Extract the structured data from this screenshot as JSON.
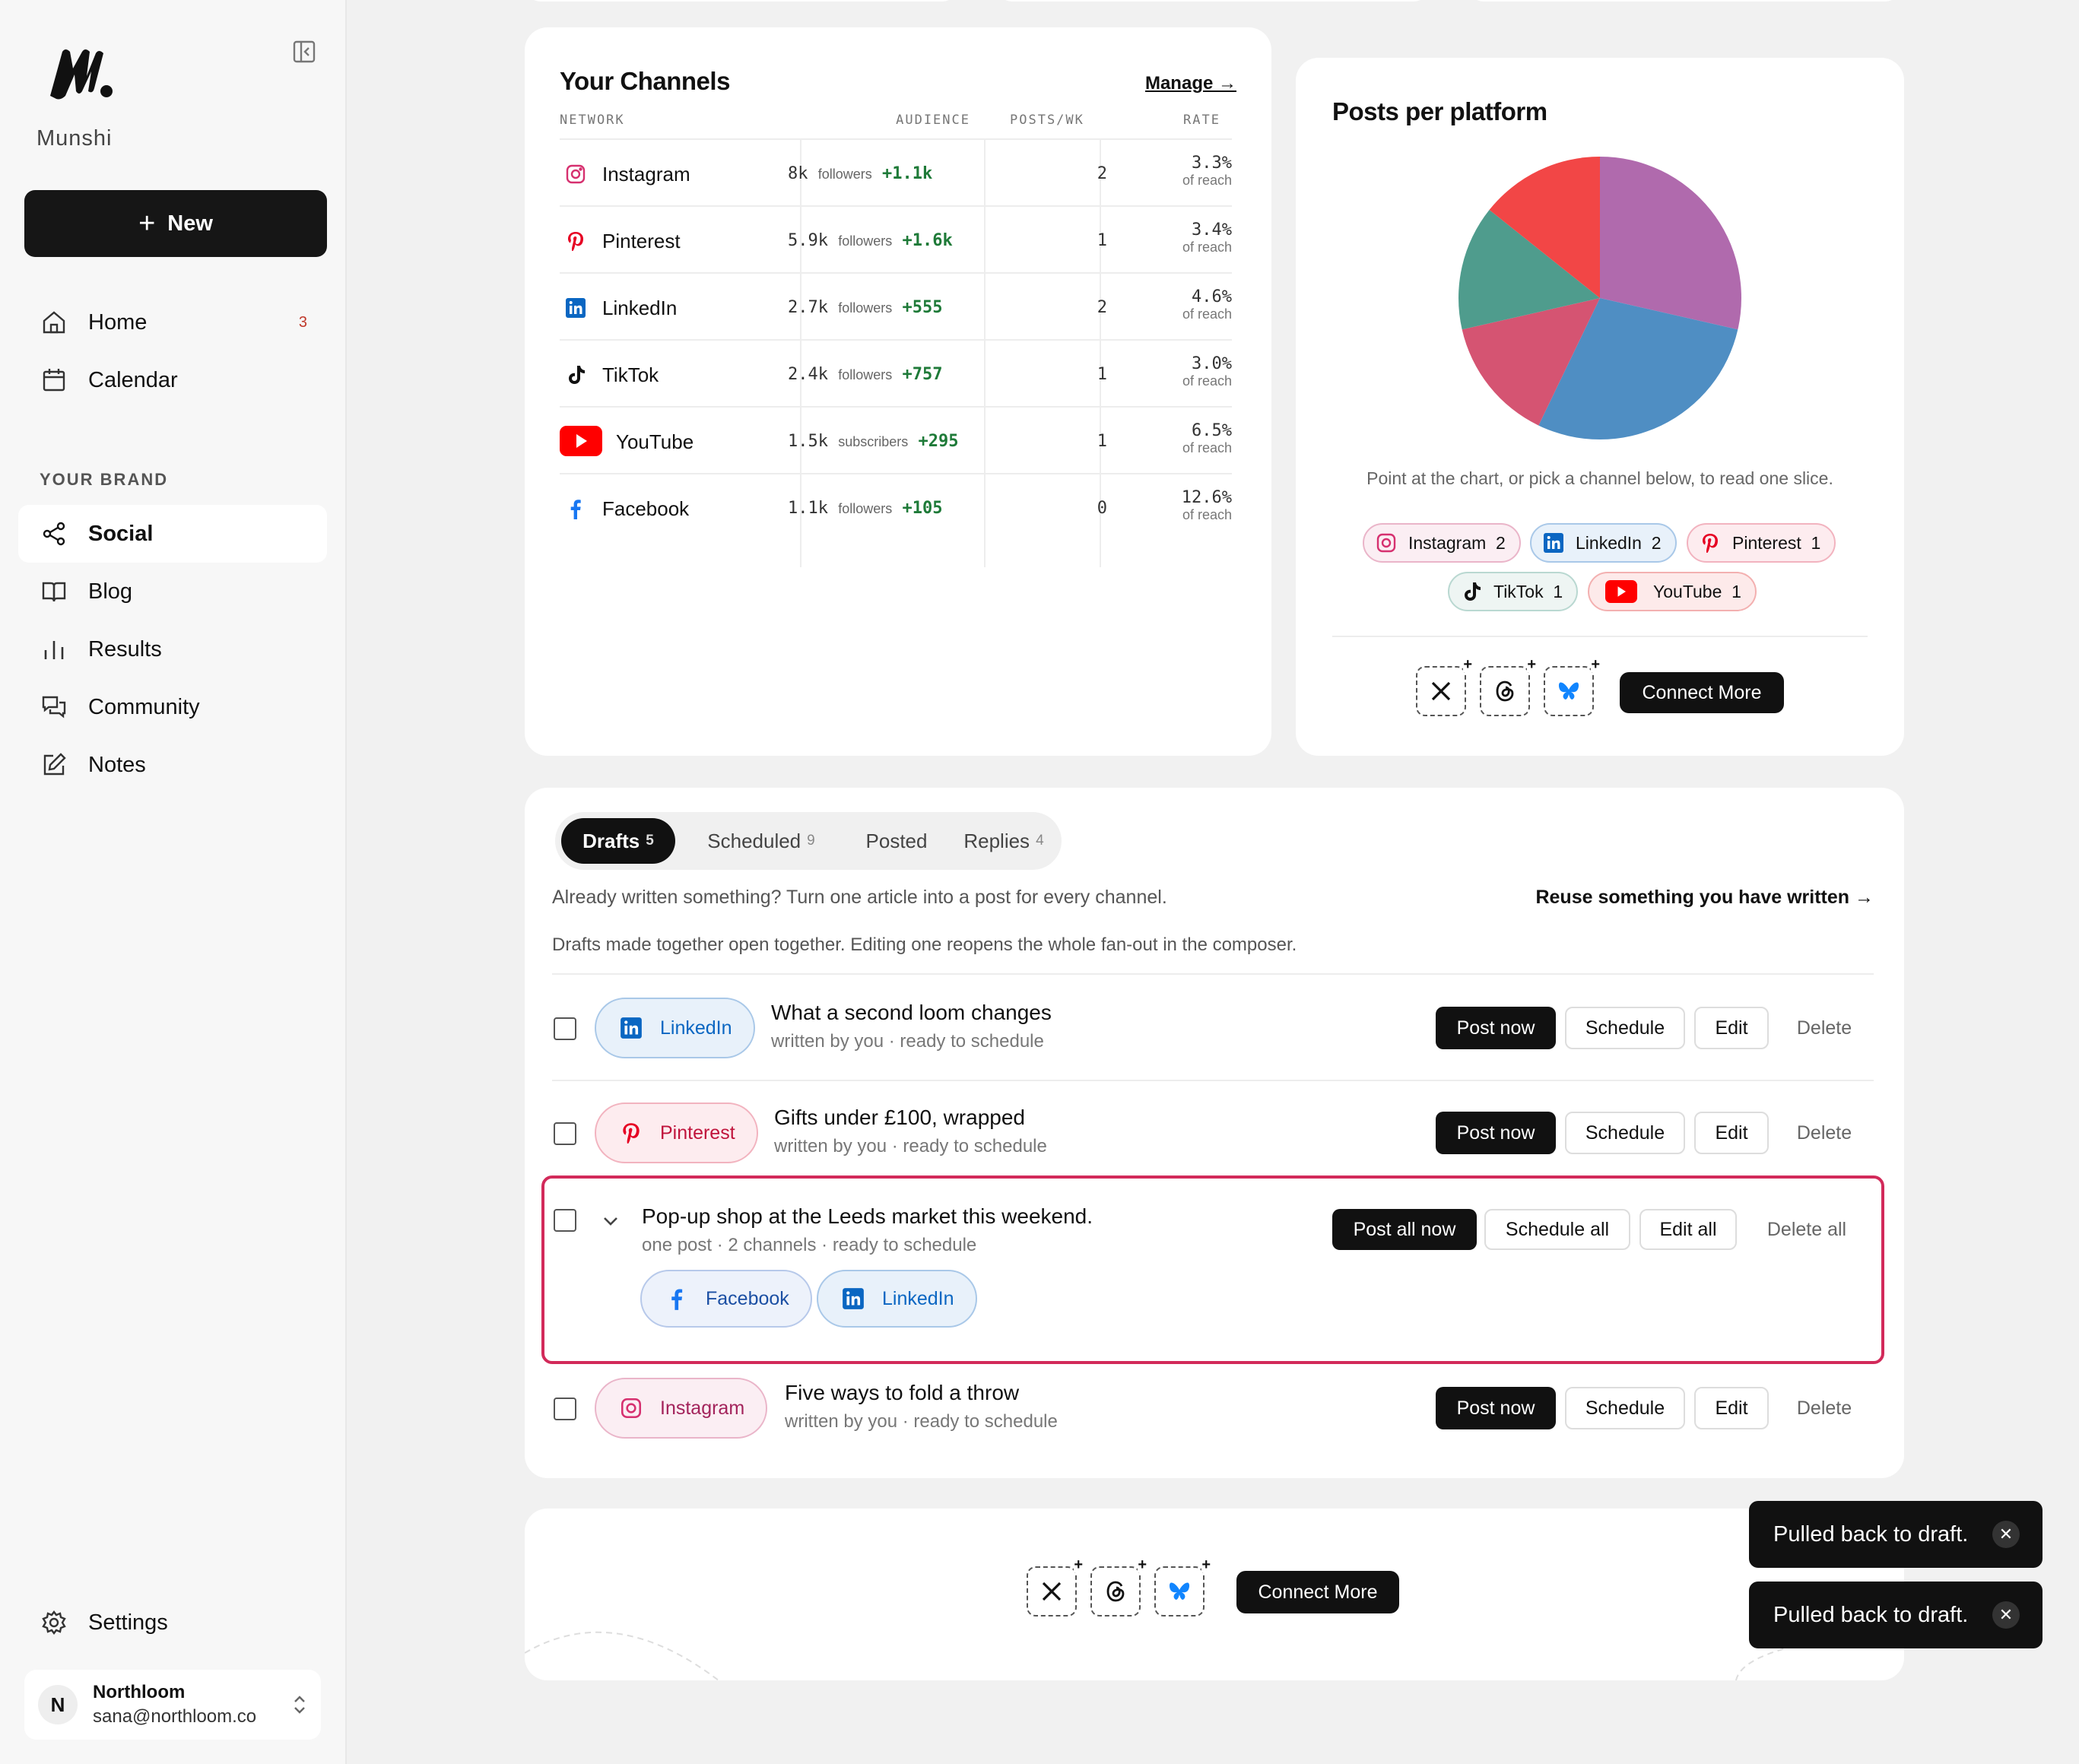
{
  "sidebar": {
    "brand": "Munshi",
    "new_label": "New",
    "nav": [
      {
        "label": "Home",
        "badge": "3",
        "icon": "home-icon"
      },
      {
        "label": "Calendar",
        "icon": "calendar-icon"
      }
    ],
    "section_label": "YOUR BRAND",
    "brand_nav": [
      {
        "label": "Social",
        "icon": "share-icon",
        "active": true
      },
      {
        "label": "Blog",
        "icon": "book-icon"
      },
      {
        "label": "Results",
        "icon": "bar-chart-icon"
      },
      {
        "label": "Community",
        "icon": "chat-icon"
      },
      {
        "label": "Notes",
        "icon": "edit-icon"
      }
    ],
    "settings_label": "Settings",
    "account": {
      "initial": "N",
      "name": "Northloom",
      "email": "sana@northloom.co"
    }
  },
  "channels": {
    "title": "Your Channels",
    "manage_label": "Manage →",
    "headers": {
      "network": "NETWORK",
      "audience": "AUDIENCE",
      "posts": "POSTS/WK",
      "rate": "RATE"
    },
    "rows": [
      {
        "name": "Instagram",
        "count": "8k",
        "unit": "followers",
        "delta": "+1.1k",
        "posts": "2",
        "rate": "3.3%",
        "rate_sub": "of reach"
      },
      {
        "name": "Pinterest",
        "count": "5.9k",
        "unit": "followers",
        "delta": "+1.6k",
        "posts": "1",
        "rate": "3.4%",
        "rate_sub": "of reach"
      },
      {
        "name": "LinkedIn",
        "count": "2.7k",
        "unit": "followers",
        "delta": "+555",
        "posts": "2",
        "rate": "4.6%",
        "rate_sub": "of reach"
      },
      {
        "name": "TikTok",
        "count": "2.4k",
        "unit": "followers",
        "delta": "+757",
        "posts": "1",
        "rate": "3.0%",
        "rate_sub": "of reach"
      },
      {
        "name": "YouTube",
        "count": "1.5k",
        "unit": "subscribers",
        "delta": "+295",
        "posts": "1",
        "rate": "6.5%",
        "rate_sub": "of reach"
      },
      {
        "name": "Facebook",
        "count": "1.1k",
        "unit": "followers",
        "delta": "+105",
        "posts": "0",
        "rate": "12.6%",
        "rate_sub": "of reach"
      }
    ]
  },
  "platform": {
    "title": "Posts per platform",
    "hint": "Point at the chart, or pick a channel below, to read one slice.",
    "pills": [
      {
        "label": "Instagram",
        "count": "2"
      },
      {
        "label": "LinkedIn",
        "count": "2"
      },
      {
        "label": "Pinterest",
        "count": "1"
      },
      {
        "label": "TikTok",
        "count": "1"
      },
      {
        "label": "YouTube",
        "count": "1"
      }
    ],
    "connect_label": "Connect More",
    "colors": {
      "Instagram": "#b06aad",
      "LinkedIn": "#4f8ec3",
      "Pinterest": "#d55472",
      "TikTok": "#4f9c8d",
      "YouTube": "#f24646"
    }
  },
  "chart_data": {
    "type": "pie",
    "title": "Posts per platform",
    "categories": [
      "Instagram",
      "LinkedIn",
      "Pinterest",
      "TikTok",
      "YouTube"
    ],
    "values": [
      2,
      2,
      1,
      1,
      1
    ]
  },
  "drafts": {
    "tabs": [
      {
        "label": "Drafts",
        "count": "5"
      },
      {
        "label": "Scheduled",
        "count": "9"
      },
      {
        "label": "Posted",
        "count": ""
      },
      {
        "label": "Replies",
        "count": "4"
      }
    ],
    "intro": "Already written something? Turn one article into a post for every channel.",
    "reuse_label": "Reuse something you have written →",
    "note": "Drafts made together open together. Editing one reopens the whole fan-out in the composer.",
    "items": [
      {
        "channel": "LinkedIn",
        "title": "What a second loom changes",
        "sub": "written by you · ready to schedule"
      },
      {
        "channel": "Pinterest",
        "title": "Gifts under £100, wrapped",
        "sub": "written by you · ready to schedule"
      },
      {
        "channel": "Instagram",
        "title": "Five ways to fold a throw",
        "sub": "written by you · ready to schedule"
      }
    ],
    "group": {
      "title": "Pop-up shop at the Leeds market this weekend.",
      "sub": "one post · 2 channels · ready to schedule",
      "channels": [
        "Facebook",
        "LinkedIn"
      ],
      "post_all": "Post all now",
      "schedule_all": "Schedule all",
      "edit_all": "Edit all",
      "delete_all": "Delete all"
    },
    "actions": {
      "post": "Post now",
      "schedule": "Schedule",
      "edit": "Edit",
      "delete": "Delete"
    }
  },
  "footer_card": {
    "connect_label": "Connect More"
  },
  "toasts": [
    "Pulled back to draft.",
    "Pulled back to draft."
  ]
}
